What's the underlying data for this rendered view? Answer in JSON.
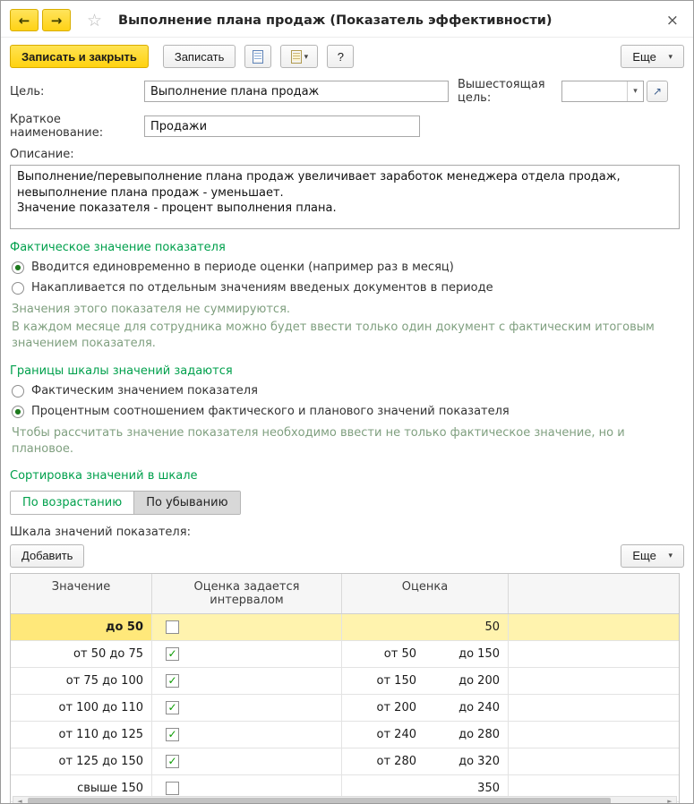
{
  "window": {
    "title": "Выполнение плана продаж (Показатель эффективности)",
    "back_glyph": "←",
    "forward_glyph": "→",
    "star_glyph": "☆",
    "close_glyph": "×"
  },
  "toolbar": {
    "save_close": "Записать и закрыть",
    "save": "Записать",
    "help": "?",
    "more": "Еще",
    "dropdown_glyph": "▾"
  },
  "fields": {
    "goal_label": "Цель:",
    "goal_value": "Выполнение плана продаж",
    "parent_goal_label": "Вышестоящая цель:",
    "parent_goal_value": "",
    "open_glyph": "↗",
    "short_name_label": "Краткое наименование:",
    "short_name_value": "Продажи",
    "description_label": "Описание:",
    "description_value": "Выполнение/перевыполнение плана продаж увеличивает заработок менеджера отдела продаж, невыполнение плана продаж - уменьшает.\nЗначение показателя - процент выполнения плана."
  },
  "colors": {
    "accent_yellow": "#ffd215",
    "section_green": "#00a04c",
    "hint_green": "#7f9f7f",
    "selected_row": "#fff3ae"
  },
  "sections": {
    "actual": {
      "title": "Фактическое значение показателя",
      "options": [
        {
          "label": "Вводится единовременно в периоде оценки (например раз в месяц)",
          "dot": "●"
        },
        {
          "label": "Накапливается по отдельным значениям введеных документов в периоде",
          "dot": ""
        }
      ],
      "hint1": "Значения этого показателя не суммируются.",
      "hint2": "В каждом месяце для сотрудника можно будет ввести только один документ с фактическим итоговым значением показателя."
    },
    "bounds": {
      "title": "Границы шкалы значений задаются",
      "options": [
        {
          "label": "Фактическим значением показателя",
          "dot": ""
        },
        {
          "label": "Процентным соотношением фактического и планового значений показателя",
          "dot": "●"
        }
      ],
      "hint": "Чтобы рассчитать значение показателя необходимо ввести не только фактическое значение, но и плановое."
    },
    "sorting": {
      "title": "Сортировка значений в шкале",
      "asc": "По возрастанию",
      "desc": "По убыванию"
    }
  },
  "scale": {
    "label": "Шкала значений показателя:",
    "add_button": "Добавить",
    "more_button": "Еще",
    "columns": {
      "value": "Значение",
      "interval": "Оценка задается интервалом",
      "score": "Оценка",
      "extra": ""
    },
    "rows": [
      {
        "value": "до 50",
        "check": "",
        "from": "",
        "to": "50"
      },
      {
        "value": "от 50 до 75",
        "check": "✓",
        "from": "от 50",
        "to": "до 150"
      },
      {
        "value": "от 75 до 100",
        "check": "✓",
        "from": "от 150",
        "to": "до 200"
      },
      {
        "value": "от 100 до 110",
        "check": "✓",
        "from": "от 200",
        "to": "до 240"
      },
      {
        "value": "от 110 до 125",
        "check": "✓",
        "from": "от 240",
        "to": "до 280"
      },
      {
        "value": "от 125 до 150",
        "check": "✓",
        "from": "от 280",
        "to": "до 320"
      },
      {
        "value": "свыше 150",
        "check": "",
        "from": "",
        "to": "350"
      }
    ],
    "scroll_left_glyph": "◄",
    "scroll_right_glyph": "►"
  }
}
